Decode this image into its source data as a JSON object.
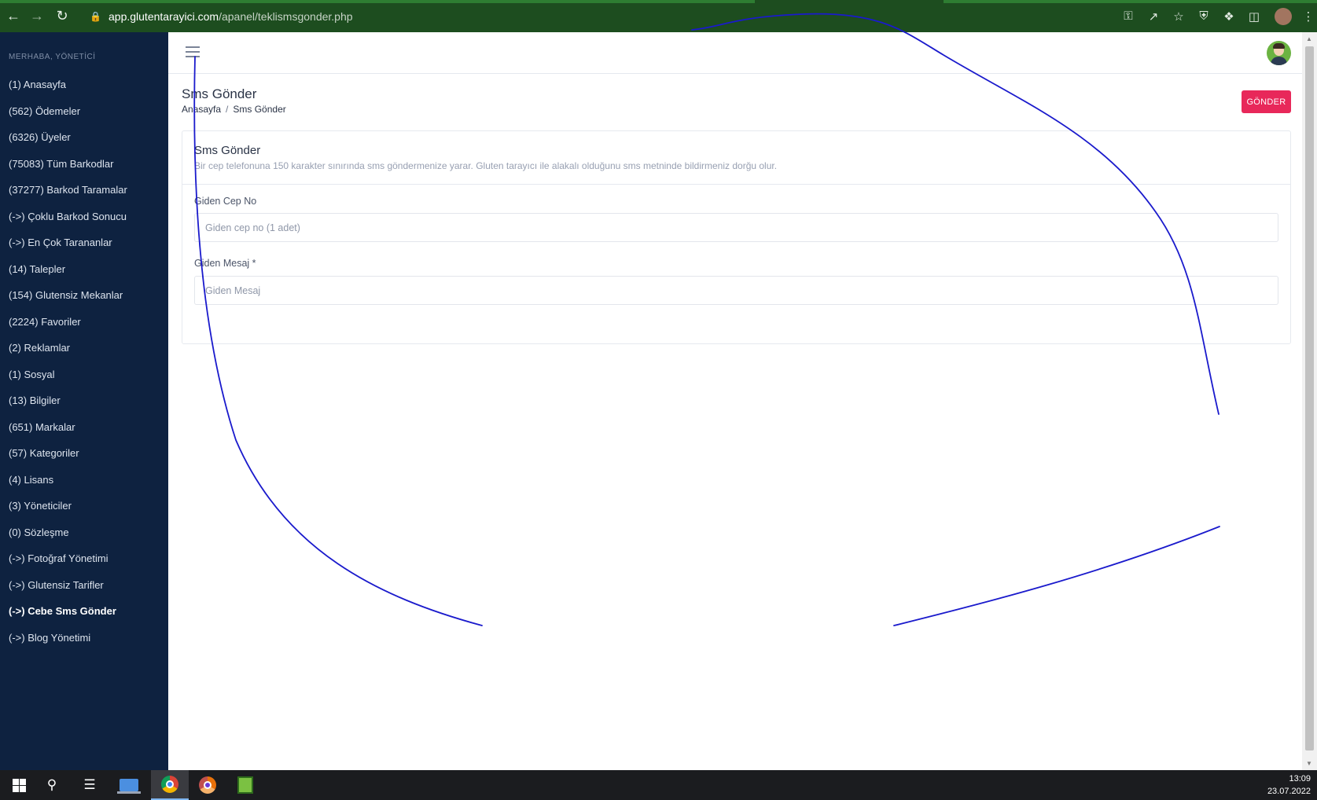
{
  "browser": {
    "url_host": "app.glutentarayici.com",
    "url_path": "/apanel/teklismsgonder.php",
    "icons": [
      "back-icon",
      "forward-icon",
      "reload-icon",
      "lock-icon",
      "key-icon",
      "share-icon",
      "star-icon",
      "shield-icon",
      "extensions-icon",
      "sidepanel-icon",
      "profile-icon",
      "menu-icon"
    ],
    "theme_color": "#1d4d1f"
  },
  "sidebar": {
    "greeting": "MERHABA, YÖNETİCİ",
    "items": [
      {
        "label": "(1)  Anasayfa"
      },
      {
        "label": "(562)  Ödemeler"
      },
      {
        "label": "(6326)  Üyeler"
      },
      {
        "label": "(75083)  Tüm Barkodlar"
      },
      {
        "label": "(37277)  Barkod Taramalar"
      },
      {
        "label": "(->)  Çoklu Barkod Sonucu"
      },
      {
        "label": "(->)  En Çok Tarananlar"
      },
      {
        "label": "(14)  Talepler"
      },
      {
        "label": "(154)  Glutensiz Mekanlar"
      },
      {
        "label": "(2224)  Favoriler"
      },
      {
        "label": "(2)  Reklamlar"
      },
      {
        "label": "(1)  Sosyal"
      },
      {
        "label": "(13)  Bilgiler"
      },
      {
        "label": "(651)  Markalar"
      },
      {
        "label": "(57)  Kategoriler"
      },
      {
        "label": "(4)  Lisans"
      },
      {
        "label": "(3)  Yöneticiler"
      },
      {
        "label": "(0)  Sözleşme"
      },
      {
        "label": "(->)  Fotoğraf Yönetimi"
      },
      {
        "label": "(->)  Glutensiz Tarifler"
      },
      {
        "label": "(->)  Cebe Sms Gönder"
      },
      {
        "label": "(->)  Blog Yönetimi"
      }
    ],
    "active_index": 20,
    "bg_color": "#0e2240"
  },
  "header": {
    "page_title": "Sms Gönder",
    "breadcrumb_home": "Anasayfa",
    "breadcrumb_sep": "/",
    "breadcrumb_current": "Sms Gönder",
    "send_button": "GÖNDER",
    "send_button_color": "#e8285a"
  },
  "card": {
    "title": "Sms Gönder",
    "subtitle": "Bir cep telefonuna 150 karakter sınırında sms göndermenize yarar. Gluten tarayıcı ile alakalı olduğunu sms metninde bildirmeniz dorğu olur.",
    "phone_label": "Giden Cep No",
    "phone_placeholder": "Giden cep no (1 adet)",
    "phone_value": "",
    "message_label": "Giden Mesaj *",
    "message_placeholder": "Giden Mesaj",
    "message_value": ""
  },
  "taskbar": {
    "time": "13:09",
    "date": "23.07.2022",
    "icons": [
      "windows-start-icon",
      "search-icon",
      "task-view-icon",
      "laptop-app-icon",
      "chrome-icon",
      "chrome-canary-icon",
      "notepad-icon"
    ]
  },
  "annotation": {
    "stroke_color": "#1a1acc"
  }
}
